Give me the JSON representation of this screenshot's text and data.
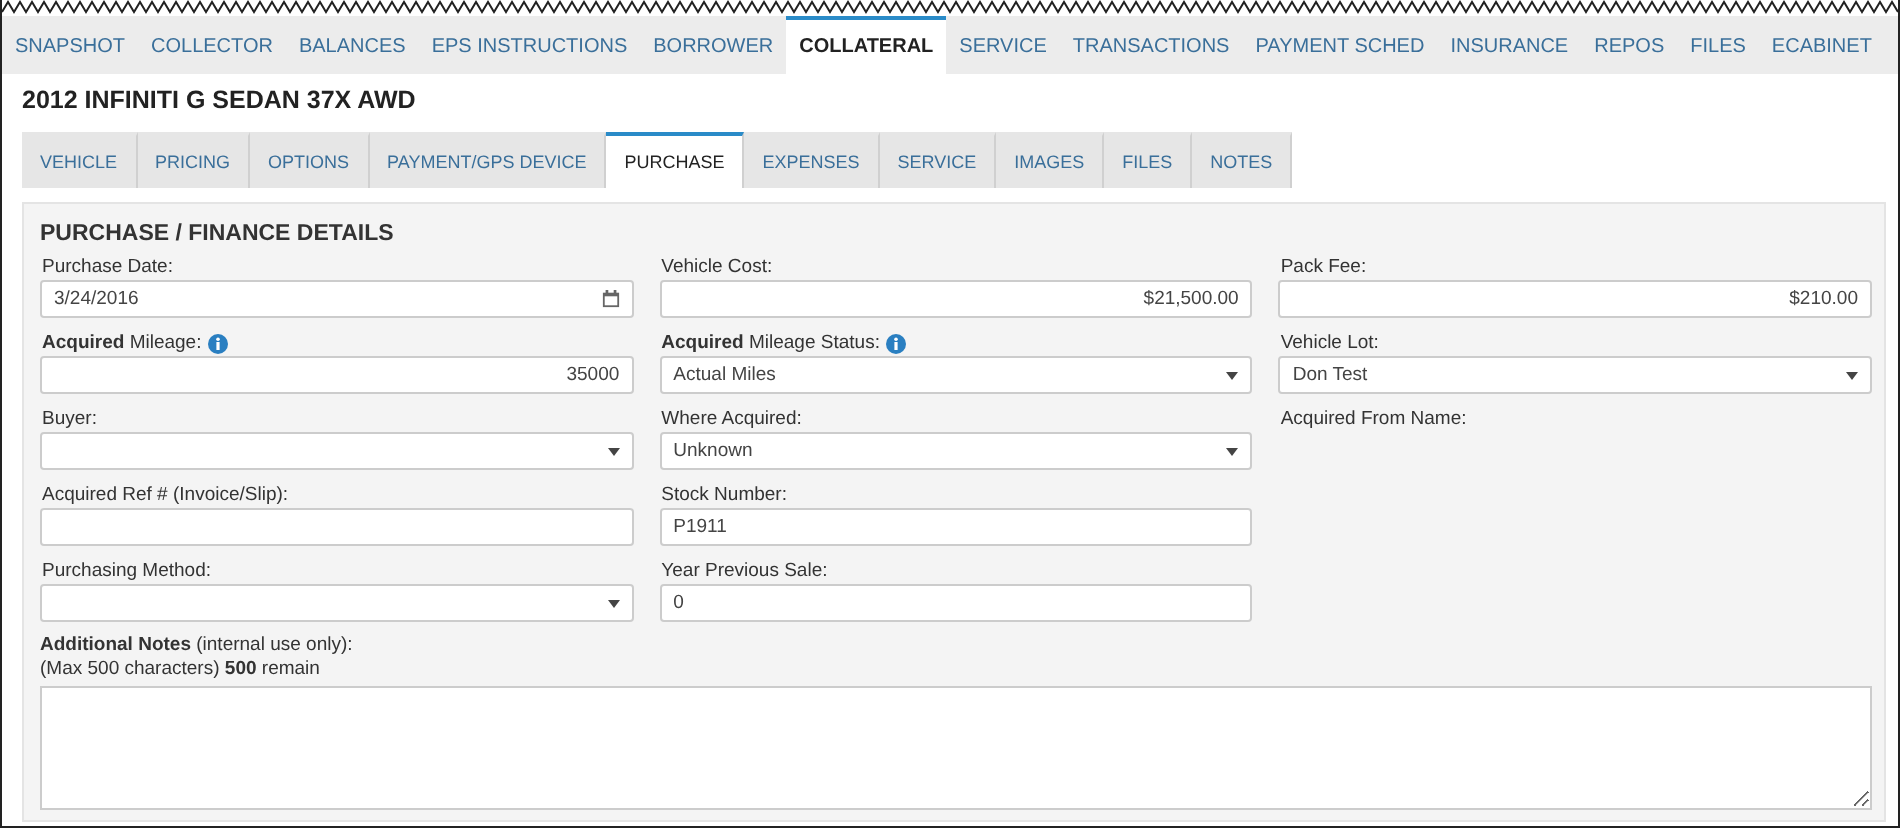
{
  "main_tabs": [
    {
      "label": "SNAPSHOT",
      "selected": false
    },
    {
      "label": "COLLECTOR",
      "selected": false
    },
    {
      "label": "BALANCES",
      "selected": false
    },
    {
      "label": "EPS INSTRUCTIONS",
      "selected": false
    },
    {
      "label": "BORROWER",
      "selected": false
    },
    {
      "label": "COLLATERAL",
      "selected": true
    },
    {
      "label": "SERVICE",
      "selected": false
    },
    {
      "label": "TRANSACTIONS",
      "selected": false
    },
    {
      "label": "PAYMENT SCHED",
      "selected": false
    },
    {
      "label": "INSURANCE",
      "selected": false
    },
    {
      "label": "REPOS",
      "selected": false
    },
    {
      "label": "FILES",
      "selected": false
    },
    {
      "label": "ECABINET",
      "selected": false
    }
  ],
  "vehicle_title": "2012 INFINITI G SEDAN 37X AWD",
  "sub_tabs": [
    {
      "label": "VEHICLE",
      "selected": false
    },
    {
      "label": "PRICING",
      "selected": false
    },
    {
      "label": "OPTIONS",
      "selected": false
    },
    {
      "label": "PAYMENT/GPS DEVICE",
      "selected": false
    },
    {
      "label": "PURCHASE",
      "selected": true
    },
    {
      "label": "EXPENSES",
      "selected": false
    },
    {
      "label": "SERVICE",
      "selected": false
    },
    {
      "label": "IMAGES",
      "selected": false
    },
    {
      "label": "FILES",
      "selected": false
    },
    {
      "label": "NOTES",
      "selected": false
    }
  ],
  "section_title": "PURCHASE / FINANCE DETAILS",
  "form_rows": [
    [
      {
        "kind": "date",
        "label": "Purchase Date:",
        "info": false,
        "value": "3/24/2016"
      },
      {
        "kind": "number",
        "label": "Vehicle Cost:",
        "info": false,
        "value": "$21,500.00"
      },
      {
        "kind": "number",
        "label": "Pack Fee:",
        "info": false,
        "value": "$210.00"
      }
    ],
    [
      {
        "kind": "number",
        "label": "**Acquired** Mileage:",
        "info": true,
        "value": "35000"
      },
      {
        "kind": "select",
        "label": "**Acquired** Mileage Status:",
        "info": true,
        "value": "Actual Miles"
      },
      {
        "kind": "select",
        "label": "Vehicle Lot:",
        "info": false,
        "value": "Don Test"
      }
    ],
    [
      {
        "kind": "select",
        "label": "Buyer:",
        "info": false
      },
      {
        "kind": "select",
        "label": "Where Acquired:",
        "info": false,
        "value": "Unknown"
      },
      {
        "kind": "label",
        "label": "Acquired From Name:",
        "info": false
      }
    ],
    [
      {
        "kind": "text",
        "label": "Acquired Ref # (Invoice/Slip):",
        "info": false
      },
      {
        "kind": "text",
        "label": "Stock Number:",
        "info": false,
        "value": "P1911"
      }
    ],
    [
      {
        "kind": "select",
        "label": "Purchasing Method:",
        "info": false
      },
      {
        "kind": "text",
        "label": "Year Previous Sale:",
        "info": false,
        "value": "0"
      }
    ]
  ],
  "notes": {
    "label": "**Additional Notes** (internal use only):",
    "limit": "(Max 500 characters) **500** remain"
  }
}
